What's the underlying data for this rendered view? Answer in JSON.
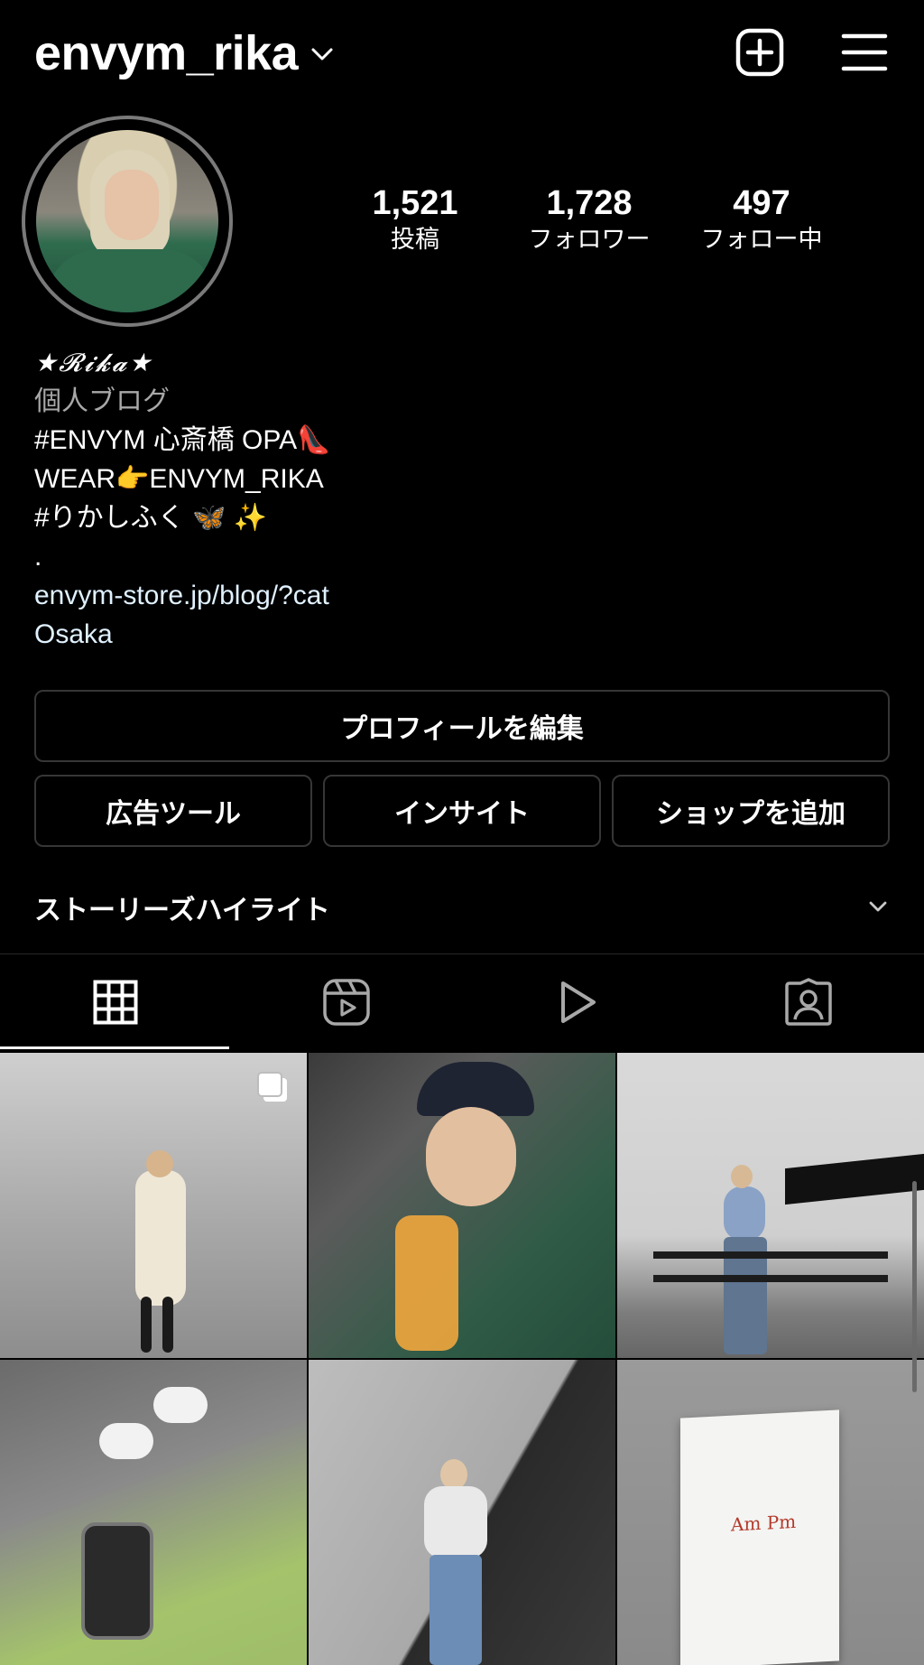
{
  "header": {
    "username": "envym_rika",
    "icons": {
      "dropdown": "chevron-down-icon",
      "new_post": "plus-square-icon",
      "menu": "hamburger-menu-icon"
    }
  },
  "profile": {
    "stats": [
      {
        "value": "1,521",
        "label": "投稿"
      },
      {
        "value": "1,728",
        "label": "フォロワー"
      },
      {
        "value": "497",
        "label": "フォロー中"
      }
    ]
  },
  "bio": {
    "display_name": "★𝓡𝓲𝓴𝓪★",
    "category": "個人ブログ",
    "lines": [
      "#ENVYM 心斎橋 OPA👠",
      "WEAR👉ENVYM_RIKA",
      "#りかしふく 🦋 ✨",
      "."
    ],
    "link": "envym-store.jp/blog/?cat",
    "location": "Osaka"
  },
  "buttons": {
    "edit_profile": "プロフィールを編集",
    "ad_tools": "広告ツール",
    "insights": "インサイト",
    "add_shop": "ショップを追加"
  },
  "highlights": {
    "label": "ストーリーズハイライト"
  },
  "tabs": [
    {
      "icon": "grid-icon",
      "active": true
    },
    {
      "icon": "reels-icon",
      "active": false
    },
    {
      "icon": "video-play-icon",
      "active": false
    },
    {
      "icon": "tagged-user-icon",
      "active": false
    }
  ],
  "grid": {
    "posts": [
      {
        "label": "post-1",
        "multi": true
      },
      {
        "label": "post-2",
        "multi": false
      },
      {
        "label": "post-3",
        "multi": false
      },
      {
        "label": "post-4",
        "multi": false
      },
      {
        "label": "post-5",
        "multi": false
      },
      {
        "label": "post-6",
        "multi": false,
        "text": "Am Pm"
      }
    ]
  }
}
